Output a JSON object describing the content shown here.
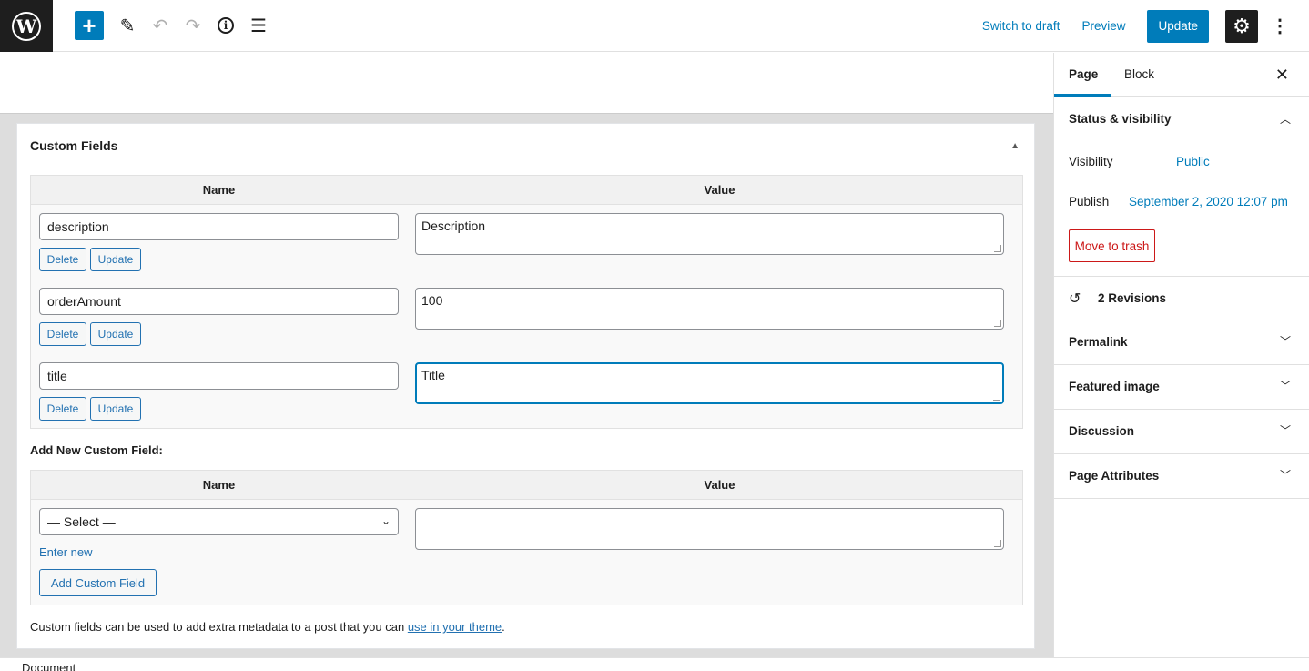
{
  "topbar": {
    "add_label": "+",
    "switch_draft": "Switch to draft",
    "preview": "Preview",
    "update": "Update"
  },
  "custom_fields": {
    "title": "Custom Fields",
    "name_header": "Name",
    "value_header": "Value",
    "rows": [
      {
        "name": "description",
        "value": "Description"
      },
      {
        "name": "orderAmount",
        "value": "100"
      },
      {
        "name": "title",
        "value": "Title"
      }
    ],
    "delete_label": "Delete",
    "update_label": "Update",
    "add_new_label": "Add New Custom Field:",
    "select_placeholder": "— Select —",
    "enter_new": "Enter new",
    "add_button": "Add Custom Field",
    "note_prefix": "Custom fields can be used to add extra metadata to a post that you can ",
    "note_link": "use in your theme",
    "note_suffix": "."
  },
  "sidebar": {
    "tab_page": "Page",
    "tab_block": "Block",
    "status_title": "Status & visibility",
    "visibility_label": "Visibility",
    "visibility_value": "Public",
    "publish_label": "Publish",
    "publish_value": "September 2, 2020 12:07 pm",
    "trash": "Move to trash",
    "revisions": "2 Revisions",
    "panels": [
      "Permalink",
      "Featured image",
      "Discussion",
      "Page Attributes"
    ]
  },
  "footer": {
    "document": "Document"
  }
}
